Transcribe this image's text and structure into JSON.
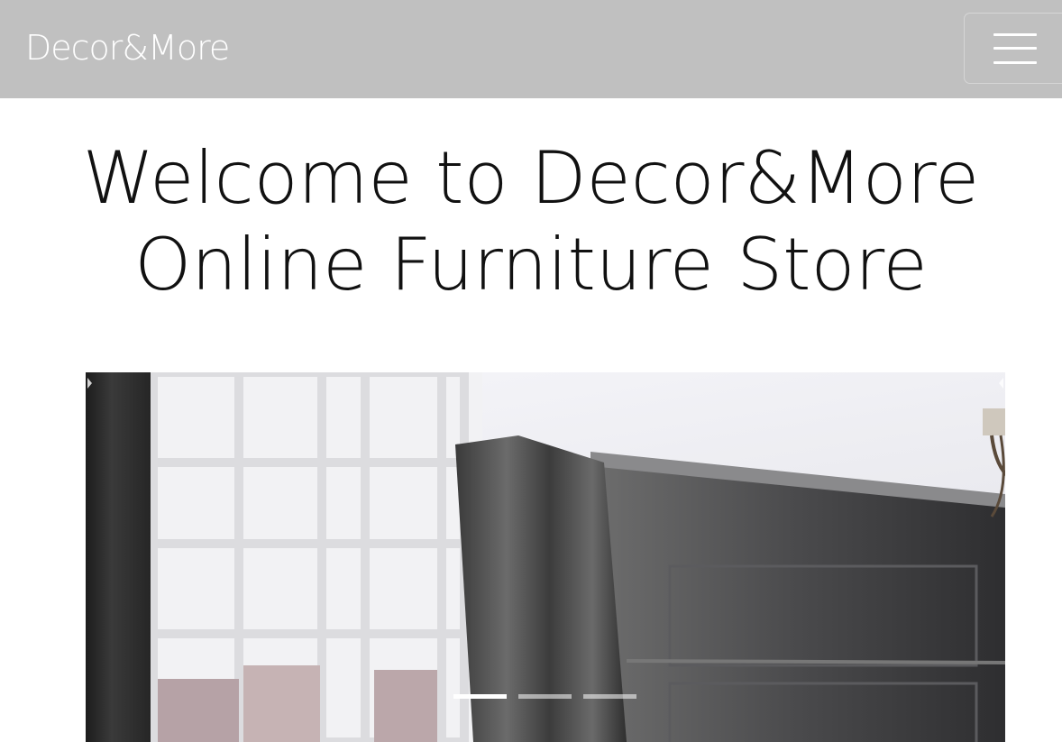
{
  "navbar": {
    "brand": "Decor&More",
    "toggler_icon": "hamburger-menu-icon",
    "background": "#c0c0c0"
  },
  "hero": {
    "title": "Welcome to Decor&More Online Furniture Store"
  },
  "carousel": {
    "slides": [
      {
        "image": "interior-room-with-window-curtains-and-chandelier"
      },
      {
        "image": "slide-2"
      },
      {
        "image": "slide-3"
      }
    ],
    "active_index": 0,
    "prev_icon": "chevron-left-icon",
    "next_icon": "chevron-right-icon"
  }
}
